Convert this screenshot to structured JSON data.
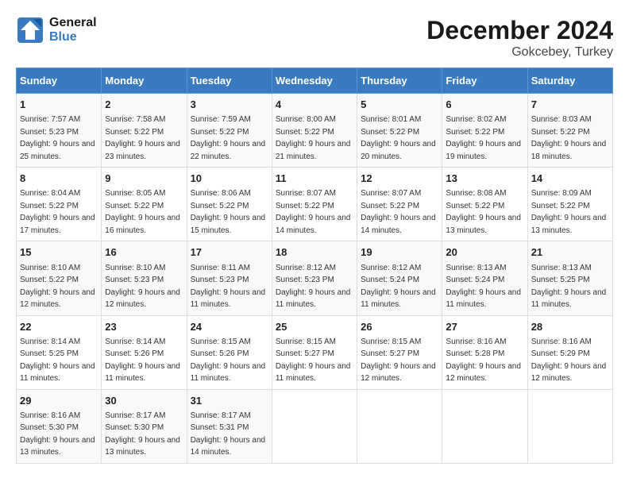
{
  "logo": {
    "line1": "General",
    "line2": "Blue"
  },
  "title": "December 2024",
  "location": "Gokcebey, Turkey",
  "weekdays": [
    "Sunday",
    "Monday",
    "Tuesday",
    "Wednesday",
    "Thursday",
    "Friday",
    "Saturday"
  ],
  "weeks": [
    [
      {
        "day": "1",
        "sunrise": "7:57 AM",
        "sunset": "5:23 PM",
        "daylight": "9 hours and 25 minutes."
      },
      {
        "day": "2",
        "sunrise": "7:58 AM",
        "sunset": "5:22 PM",
        "daylight": "9 hours and 23 minutes."
      },
      {
        "day": "3",
        "sunrise": "7:59 AM",
        "sunset": "5:22 PM",
        "daylight": "9 hours and 22 minutes."
      },
      {
        "day": "4",
        "sunrise": "8:00 AM",
        "sunset": "5:22 PM",
        "daylight": "9 hours and 21 minutes."
      },
      {
        "day": "5",
        "sunrise": "8:01 AM",
        "sunset": "5:22 PM",
        "daylight": "9 hours and 20 minutes."
      },
      {
        "day": "6",
        "sunrise": "8:02 AM",
        "sunset": "5:22 PM",
        "daylight": "9 hours and 19 minutes."
      },
      {
        "day": "7",
        "sunrise": "8:03 AM",
        "sunset": "5:22 PM",
        "daylight": "9 hours and 18 minutes."
      }
    ],
    [
      {
        "day": "8",
        "sunrise": "8:04 AM",
        "sunset": "5:22 PM",
        "daylight": "9 hours and 17 minutes."
      },
      {
        "day": "9",
        "sunrise": "8:05 AM",
        "sunset": "5:22 PM",
        "daylight": "9 hours and 16 minutes."
      },
      {
        "day": "10",
        "sunrise": "8:06 AM",
        "sunset": "5:22 PM",
        "daylight": "9 hours and 15 minutes."
      },
      {
        "day": "11",
        "sunrise": "8:07 AM",
        "sunset": "5:22 PM",
        "daylight": "9 hours and 14 minutes."
      },
      {
        "day": "12",
        "sunrise": "8:07 AM",
        "sunset": "5:22 PM",
        "daylight": "9 hours and 14 minutes."
      },
      {
        "day": "13",
        "sunrise": "8:08 AM",
        "sunset": "5:22 PM",
        "daylight": "9 hours and 13 minutes."
      },
      {
        "day": "14",
        "sunrise": "8:09 AM",
        "sunset": "5:22 PM",
        "daylight": "9 hours and 13 minutes."
      }
    ],
    [
      {
        "day": "15",
        "sunrise": "8:10 AM",
        "sunset": "5:22 PM",
        "daylight": "9 hours and 12 minutes."
      },
      {
        "day": "16",
        "sunrise": "8:10 AM",
        "sunset": "5:23 PM",
        "daylight": "9 hours and 12 minutes."
      },
      {
        "day": "17",
        "sunrise": "8:11 AM",
        "sunset": "5:23 PM",
        "daylight": "9 hours and 11 minutes."
      },
      {
        "day": "18",
        "sunrise": "8:12 AM",
        "sunset": "5:23 PM",
        "daylight": "9 hours and 11 minutes."
      },
      {
        "day": "19",
        "sunrise": "8:12 AM",
        "sunset": "5:24 PM",
        "daylight": "9 hours and 11 minutes."
      },
      {
        "day": "20",
        "sunrise": "8:13 AM",
        "sunset": "5:24 PM",
        "daylight": "9 hours and 11 minutes."
      },
      {
        "day": "21",
        "sunrise": "8:13 AM",
        "sunset": "5:25 PM",
        "daylight": "9 hours and 11 minutes."
      }
    ],
    [
      {
        "day": "22",
        "sunrise": "8:14 AM",
        "sunset": "5:25 PM",
        "daylight": "9 hours and 11 minutes."
      },
      {
        "day": "23",
        "sunrise": "8:14 AM",
        "sunset": "5:26 PM",
        "daylight": "9 hours and 11 minutes."
      },
      {
        "day": "24",
        "sunrise": "8:15 AM",
        "sunset": "5:26 PM",
        "daylight": "9 hours and 11 minutes."
      },
      {
        "day": "25",
        "sunrise": "8:15 AM",
        "sunset": "5:27 PM",
        "daylight": "9 hours and 11 minutes."
      },
      {
        "day": "26",
        "sunrise": "8:15 AM",
        "sunset": "5:27 PM",
        "daylight": "9 hours and 12 minutes."
      },
      {
        "day": "27",
        "sunrise": "8:16 AM",
        "sunset": "5:28 PM",
        "daylight": "9 hours and 12 minutes."
      },
      {
        "day": "28",
        "sunrise": "8:16 AM",
        "sunset": "5:29 PM",
        "daylight": "9 hours and 12 minutes."
      }
    ],
    [
      {
        "day": "29",
        "sunrise": "8:16 AM",
        "sunset": "5:30 PM",
        "daylight": "9 hours and 13 minutes."
      },
      {
        "day": "30",
        "sunrise": "8:17 AM",
        "sunset": "5:30 PM",
        "daylight": "9 hours and 13 minutes."
      },
      {
        "day": "31",
        "sunrise": "8:17 AM",
        "sunset": "5:31 PM",
        "daylight": "9 hours and 14 minutes."
      },
      null,
      null,
      null,
      null
    ]
  ]
}
